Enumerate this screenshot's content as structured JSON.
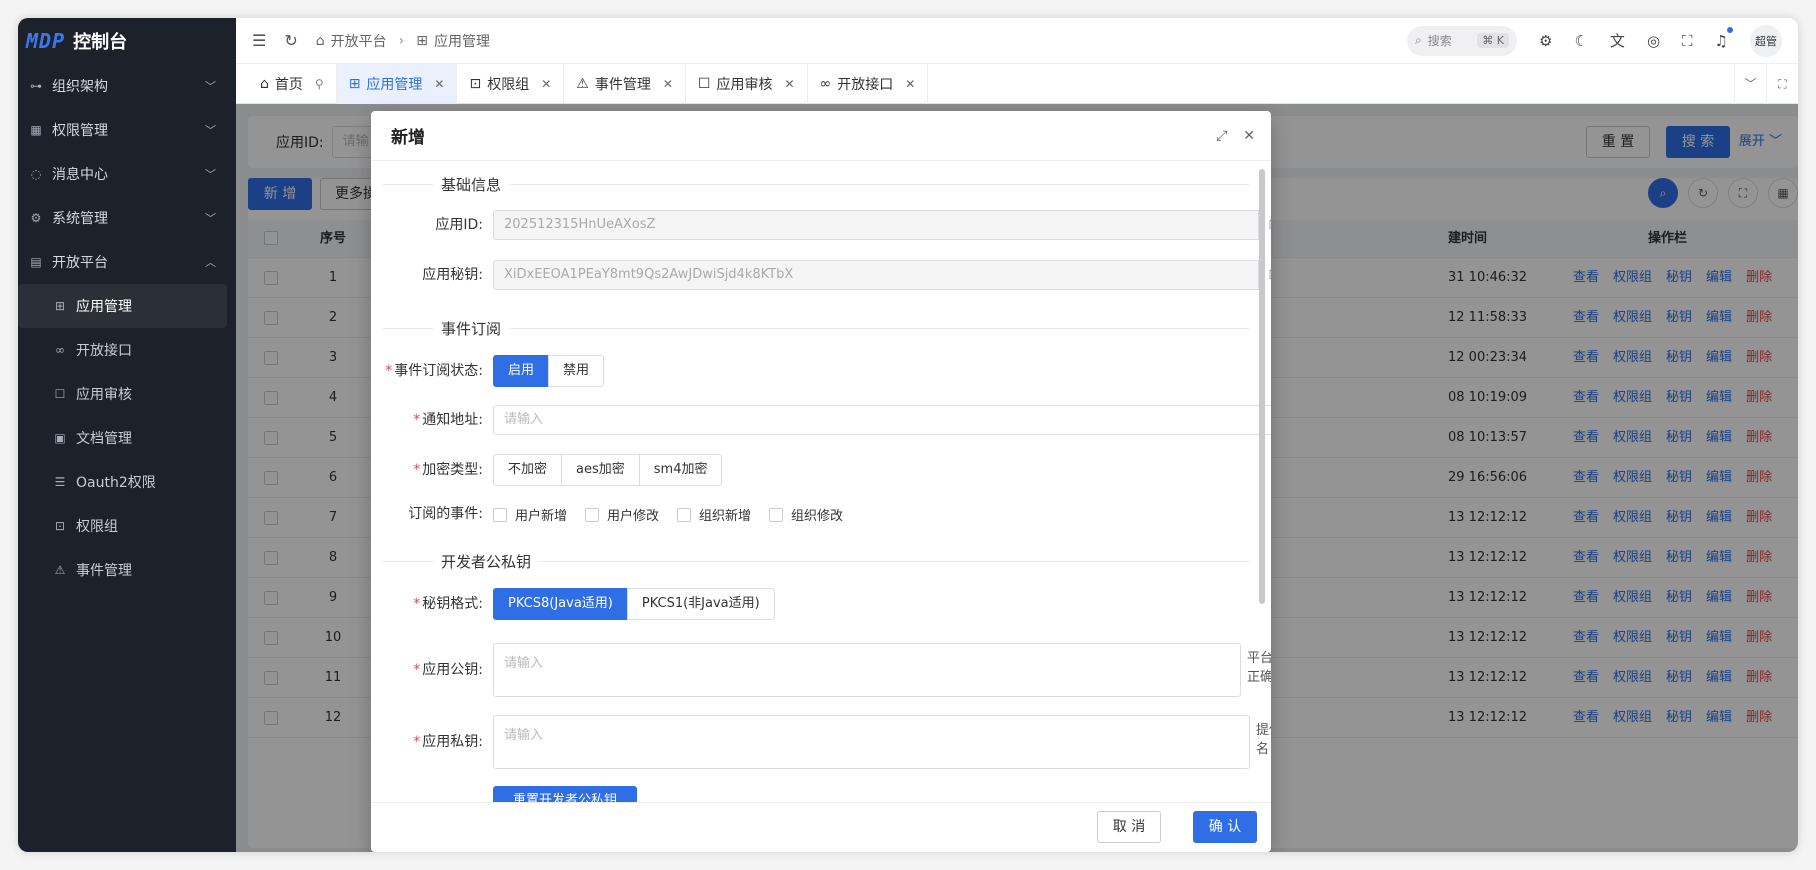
{
  "app": {
    "logo_mark": "MDP",
    "title": "控制台"
  },
  "sidebar": {
    "items": [
      {
        "label": "组织架构",
        "icon": "org-icon"
      },
      {
        "label": "权限管理",
        "icon": "permission-icon"
      },
      {
        "label": "消息中心",
        "icon": "message-icon"
      },
      {
        "label": "系统管理",
        "icon": "gear-icon"
      },
      {
        "label": "开放平台",
        "icon": "platform-icon"
      }
    ],
    "subitems": [
      {
        "label": "应用管理",
        "icon": "app-icon"
      },
      {
        "label": "开放接口",
        "icon": "link-icon"
      },
      {
        "label": "应用审核",
        "icon": "audit-icon"
      },
      {
        "label": "文档管理",
        "icon": "doc-icon"
      },
      {
        "label": "Oauth2权限",
        "icon": "oauth-icon"
      },
      {
        "label": "权限组",
        "icon": "group-icon"
      },
      {
        "label": "事件管理",
        "icon": "event-icon"
      }
    ]
  },
  "header": {
    "breadcrumb": [
      "开放平台",
      "应用管理"
    ],
    "search_placeholder": "搜索",
    "search_shortcut": "⌘ K",
    "avatar_text": "超管"
  },
  "tabs": [
    {
      "label": "首页",
      "icon": "home-icon"
    },
    {
      "label": "应用管理",
      "icon": "app-icon"
    },
    {
      "label": "权限组",
      "icon": "group-icon"
    },
    {
      "label": "事件管理",
      "icon": "event-icon"
    },
    {
      "label": "应用审核",
      "icon": "audit-icon"
    },
    {
      "label": "开放接口",
      "icon": "link-icon"
    }
  ],
  "filter": {
    "label": "应用ID:",
    "placeholder": "请输",
    "reset": "重 置",
    "search": "搜 索",
    "expand": "展开"
  },
  "table": {
    "add": "新 增",
    "more": "更多操",
    "col_no": "序号",
    "col_time": "建时间",
    "col_ops": "操作栏",
    "ops": [
      "查看",
      "权限组",
      "秘钥",
      "编辑",
      "删除"
    ],
    "rows": [
      {
        "no": "1",
        "time": "31 10:46:32"
      },
      {
        "no": "2",
        "time": "12 11:58:33"
      },
      {
        "no": "3",
        "time": "12 00:23:34"
      },
      {
        "no": "4",
        "time": "08 10:19:09"
      },
      {
        "no": "5",
        "time": "08 10:13:57"
      },
      {
        "no": "6",
        "time": "29 16:56:06"
      },
      {
        "no": "7",
        "time": "13 12:12:12"
      },
      {
        "no": "8",
        "time": "13 12:12:12"
      },
      {
        "no": "9",
        "time": "13 12:12:12"
      },
      {
        "no": "10",
        "time": "13 12:12:12"
      },
      {
        "no": "11",
        "time": "13 12:12:12"
      },
      {
        "no": "12",
        "time": "13 12:12:12"
      }
    ]
  },
  "dialog": {
    "title": "新增",
    "sec_basic": "基础信息",
    "app_id_label": "应用ID:",
    "app_id_value": "202512315HnUeAXosZ",
    "app_secret_label": "应用秘钥:",
    "app_secret_value": "XiDxEEOA1PEaY8mt9Qs2AwJDwiSjd4k8KTbX",
    "sec_event": "事件订阅",
    "event_status_label": "事件订阅状态:",
    "event_status_options": [
      "启用",
      "禁用"
    ],
    "notify_label": "通知地址:",
    "notify_placeholder": "请输入",
    "encrypt_label": "加密类型:",
    "encrypt_options": [
      "不加密",
      "aes加密",
      "sm4加密"
    ],
    "events_label": "订阅的事件:",
    "events_options": [
      "用户新增",
      "用户修改",
      "组织新增",
      "组织修改"
    ],
    "sec_keys": "开发者公私钥",
    "key_format_label": "秘钥格式:",
    "key_format_options": [
      "PKCS8(Java适用)",
      "PKCS1(非Java适用)"
    ],
    "pub_label": "应用公钥:",
    "pub_placeholder": "请输入",
    "pub_hint": "平台使用，用来校验签名是否正确",
    "priv_label": "应用私钥:",
    "priv_placeholder": "请输入",
    "priv_hint": "提供给应用使用，用来生成签名",
    "regen": "重置开发者公私钥",
    "cancel": "取 消",
    "ok": "确 认"
  },
  "colors": {
    "primary": "#2f6ee5",
    "danger": "#e54545",
    "sidebar_bg": "#1d2129"
  }
}
